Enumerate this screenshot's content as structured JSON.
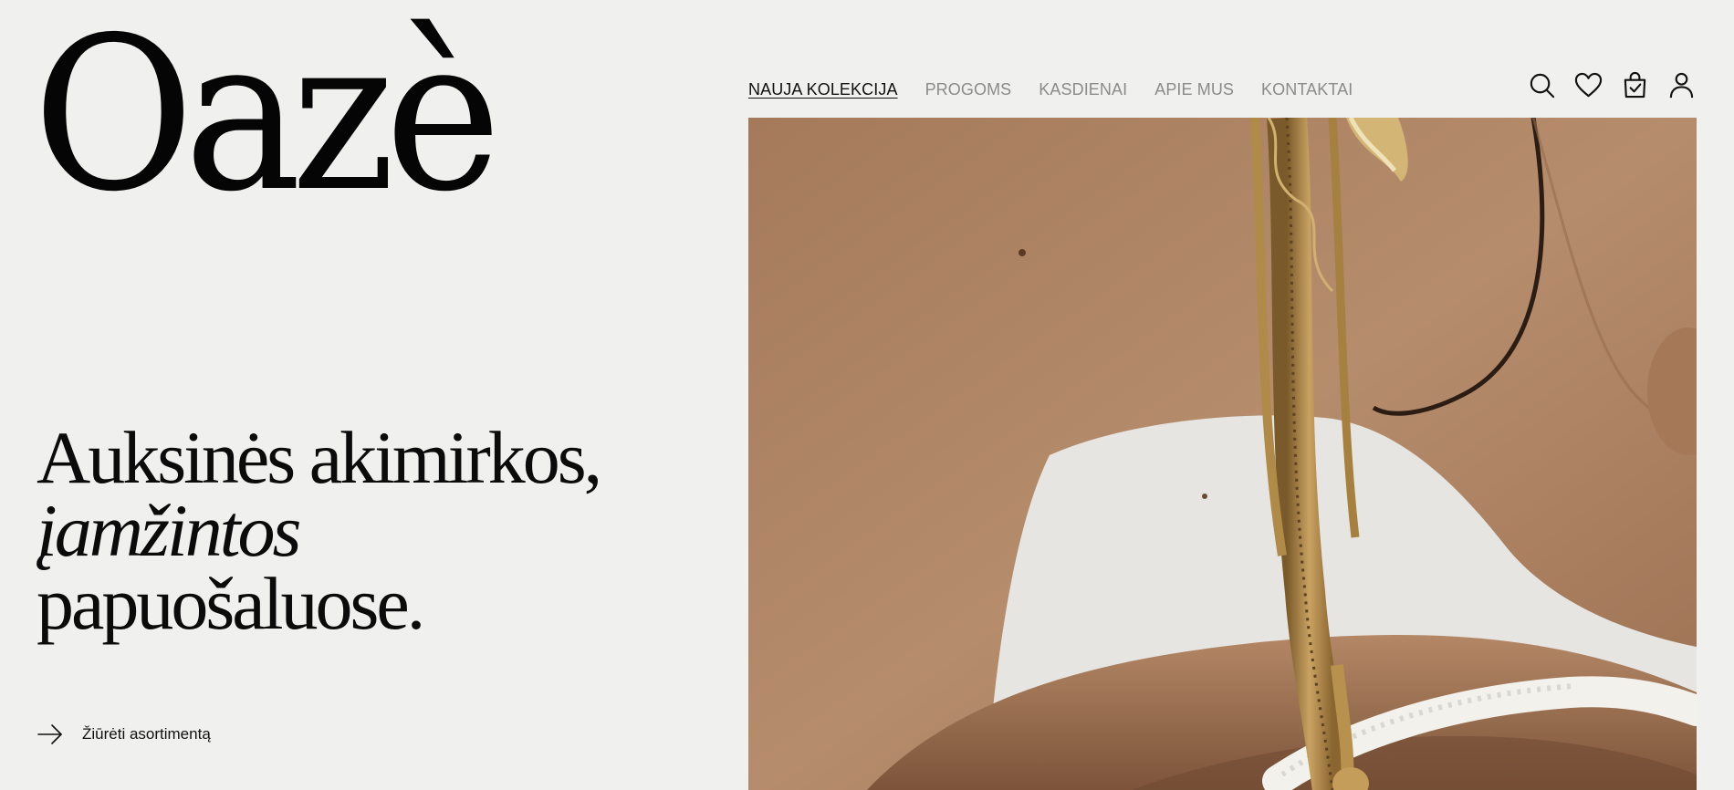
{
  "brand": {
    "logo_text": "Oazè"
  },
  "nav": {
    "items": [
      {
        "label": "NAUJA KOLEKCIJA",
        "active": true
      },
      {
        "label": "PROGOMS",
        "active": false
      },
      {
        "label": "KASDIENAI",
        "active": false
      },
      {
        "label": "APIE MUS",
        "active": false
      },
      {
        "label": "KONTAKTAI",
        "active": false
      }
    ]
  },
  "header_icons": [
    "search-icon",
    "heart-icon",
    "shopping-bag-icon",
    "user-icon"
  ],
  "hero": {
    "headline_line1": "Auksinės akimirkos,",
    "headline_line2": "įamžintos",
    "headline_line3": "papuošaluose.",
    "cta_label": "Žiūrėti asortimentą",
    "cta_icon": "arrow-right-icon",
    "image_subject": "photo of a woman's neck and shoulder wearing gold chain necklaces and a gold earring"
  },
  "colors": {
    "background": "#f0f0ef",
    "text": "#111111",
    "nav_inactive": "#8b8b8b"
  }
}
